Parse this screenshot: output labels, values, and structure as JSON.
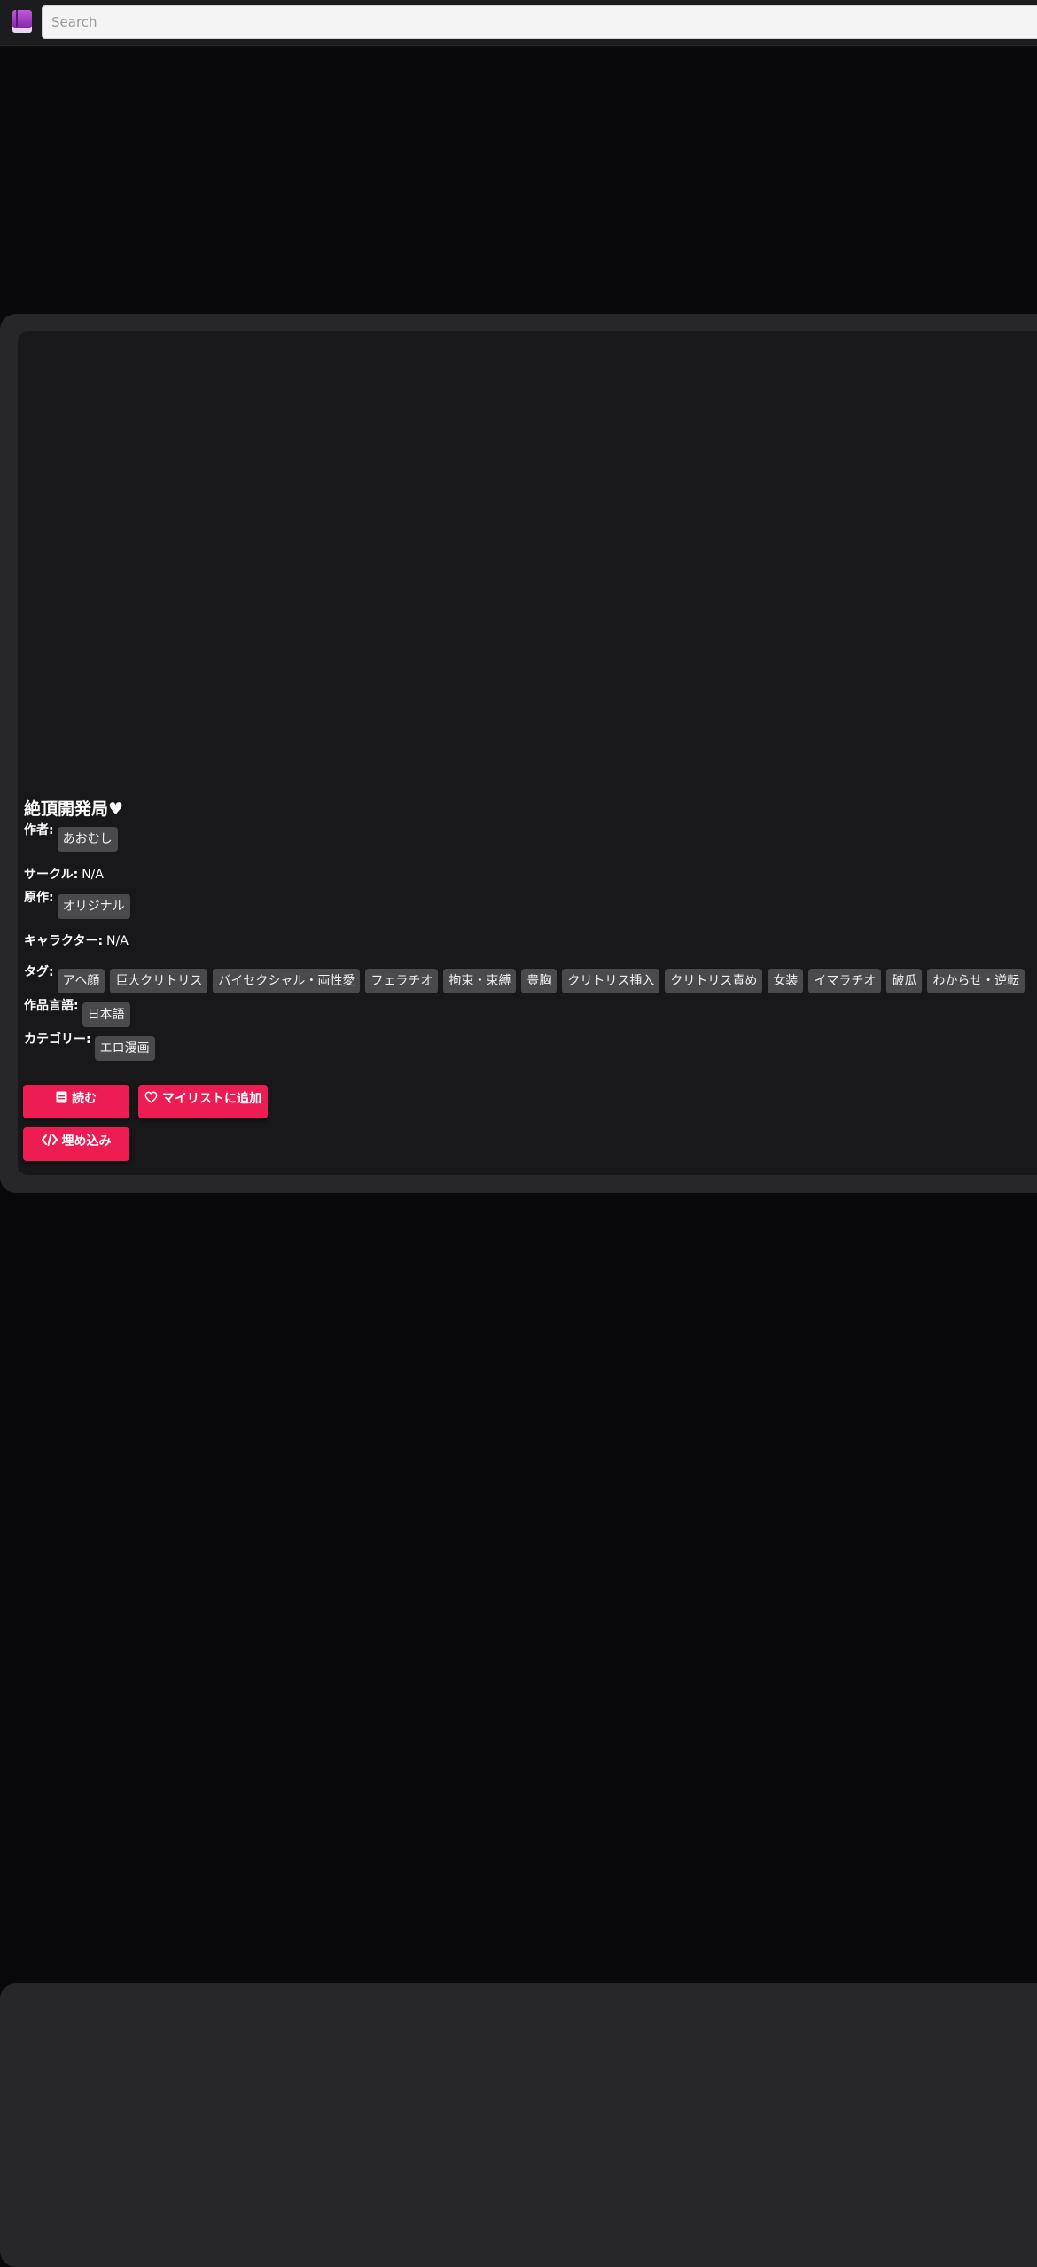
{
  "search": {
    "placeholder": "Search"
  },
  "title": "絶頂開発局♥",
  "meta": {
    "author_label": "作者:",
    "author_value": "あおむし",
    "circle_label": "サークル:",
    "circle_value": "N/A",
    "parody_label": "原作:",
    "parody_value": "オリジナル",
    "character_label": "キャラクター:",
    "character_value": "N/A",
    "tags_label": "タグ:",
    "tags": [
      "アヘ顔",
      "巨大クリトリス",
      "バイセクシャル・両性愛",
      "フェラチオ",
      "拘束・束縛",
      "豊胸",
      "クリトリス挿入",
      "クリトリス責め",
      "女装",
      "イマラチオ",
      "破瓜",
      "わからせ・逆転"
    ],
    "language_label": "作品言語:",
    "language_value": "日本語",
    "category_label": "カテゴリー:",
    "category_value": "エロ漫画"
  },
  "actions": {
    "read_label": "読む",
    "mylist_label": "マイリストに追加",
    "embed_label": "埋め込み"
  },
  "colors": {
    "accent": "#ed1c53",
    "background": "#09090b",
    "panel": "#27272a",
    "inner_panel": "#18181b",
    "tag_bg": "#4a4a4d"
  }
}
